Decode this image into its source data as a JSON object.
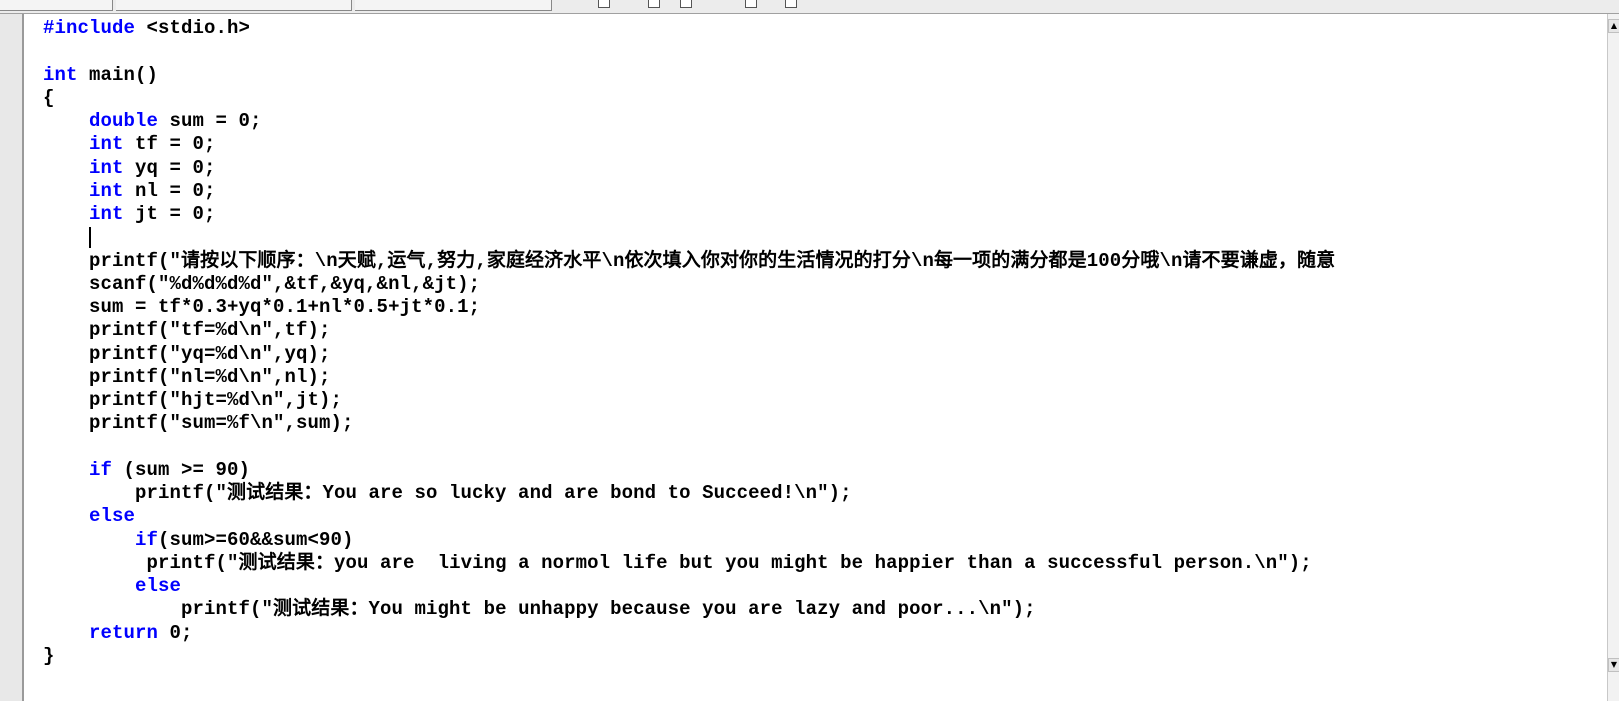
{
  "editor": {
    "lines": [
      {
        "indent": "",
        "kw": "#include",
        "rest": " <stdio.h>"
      },
      {
        "indent": "",
        "kw": "",
        "rest": ""
      },
      {
        "indent": "",
        "kw": "int",
        "rest": " main()"
      },
      {
        "indent": "",
        "kw": "",
        "rest": "{"
      },
      {
        "indent": "    ",
        "kw": "double",
        "rest": " sum = 0;"
      },
      {
        "indent": "    ",
        "kw": "int",
        "rest": " tf = 0;"
      },
      {
        "indent": "    ",
        "kw": "int",
        "rest": " yq = 0;"
      },
      {
        "indent": "    ",
        "kw": "int",
        "rest": " nl = 0;"
      },
      {
        "indent": "    ",
        "kw": "int",
        "rest": " jt = 0;"
      },
      {
        "indent": "    ",
        "kw": "",
        "rest": "",
        "caret": true
      },
      {
        "indent": "    ",
        "kw": "",
        "rest": "printf(\"请按以下顺序：\\n天赋,运气,努力,家庭经济水平\\n依次填入你对你的生活情况的打分\\n每一项的满分都是100分哦\\n请不要谦虚，随意"
      },
      {
        "indent": "    ",
        "kw": "",
        "rest": "scanf(\"%d%d%d%d\",&tf,&yq,&nl,&jt);"
      },
      {
        "indent": "    ",
        "kw": "",
        "rest": "sum = tf*0.3+yq*0.1+nl*0.5+jt*0.1;"
      },
      {
        "indent": "    ",
        "kw": "",
        "rest": "printf(\"tf=%d\\n\",tf);"
      },
      {
        "indent": "    ",
        "kw": "",
        "rest": "printf(\"yq=%d\\n\",yq);"
      },
      {
        "indent": "    ",
        "kw": "",
        "rest": "printf(\"nl=%d\\n\",nl);"
      },
      {
        "indent": "    ",
        "kw": "",
        "rest": "printf(\"hjt=%d\\n\",jt);"
      },
      {
        "indent": "    ",
        "kw": "",
        "rest": "printf(\"sum=%f\\n\",sum);"
      },
      {
        "indent": "",
        "kw": "",
        "rest": ""
      },
      {
        "indent": "    ",
        "kw": "if",
        "rest": " (sum >= 90)"
      },
      {
        "indent": "        ",
        "kw": "",
        "rest": "printf(\"测试结果：You are so lucky and are bond to Succeed!\\n\");"
      },
      {
        "indent": "    ",
        "kw": "else",
        "rest": ""
      },
      {
        "indent": "        ",
        "kw": "if",
        "rest": "(sum>=60&&sum<90)"
      },
      {
        "indent": "         ",
        "kw": "",
        "rest": "printf(\"测试结果：you are  living a normol life but you might be happier than a successful person.\\n\");"
      },
      {
        "indent": "        ",
        "kw": "else",
        "rest": ""
      },
      {
        "indent": "            ",
        "kw": "",
        "rest": "printf(\"测试结果：You might be unhappy because you are lazy and poor...\\n\");"
      },
      {
        "indent": "    ",
        "kw": "return",
        "rest": " 0;"
      },
      {
        "indent": "",
        "kw": "",
        "rest": "}"
      }
    ]
  },
  "colors": {
    "keyword": "#0000ff",
    "text": "#000000",
    "background": "#ffffff"
  },
  "scrollbar": {
    "up_icon": "triangle-up",
    "down_icon": "triangle-down"
  }
}
